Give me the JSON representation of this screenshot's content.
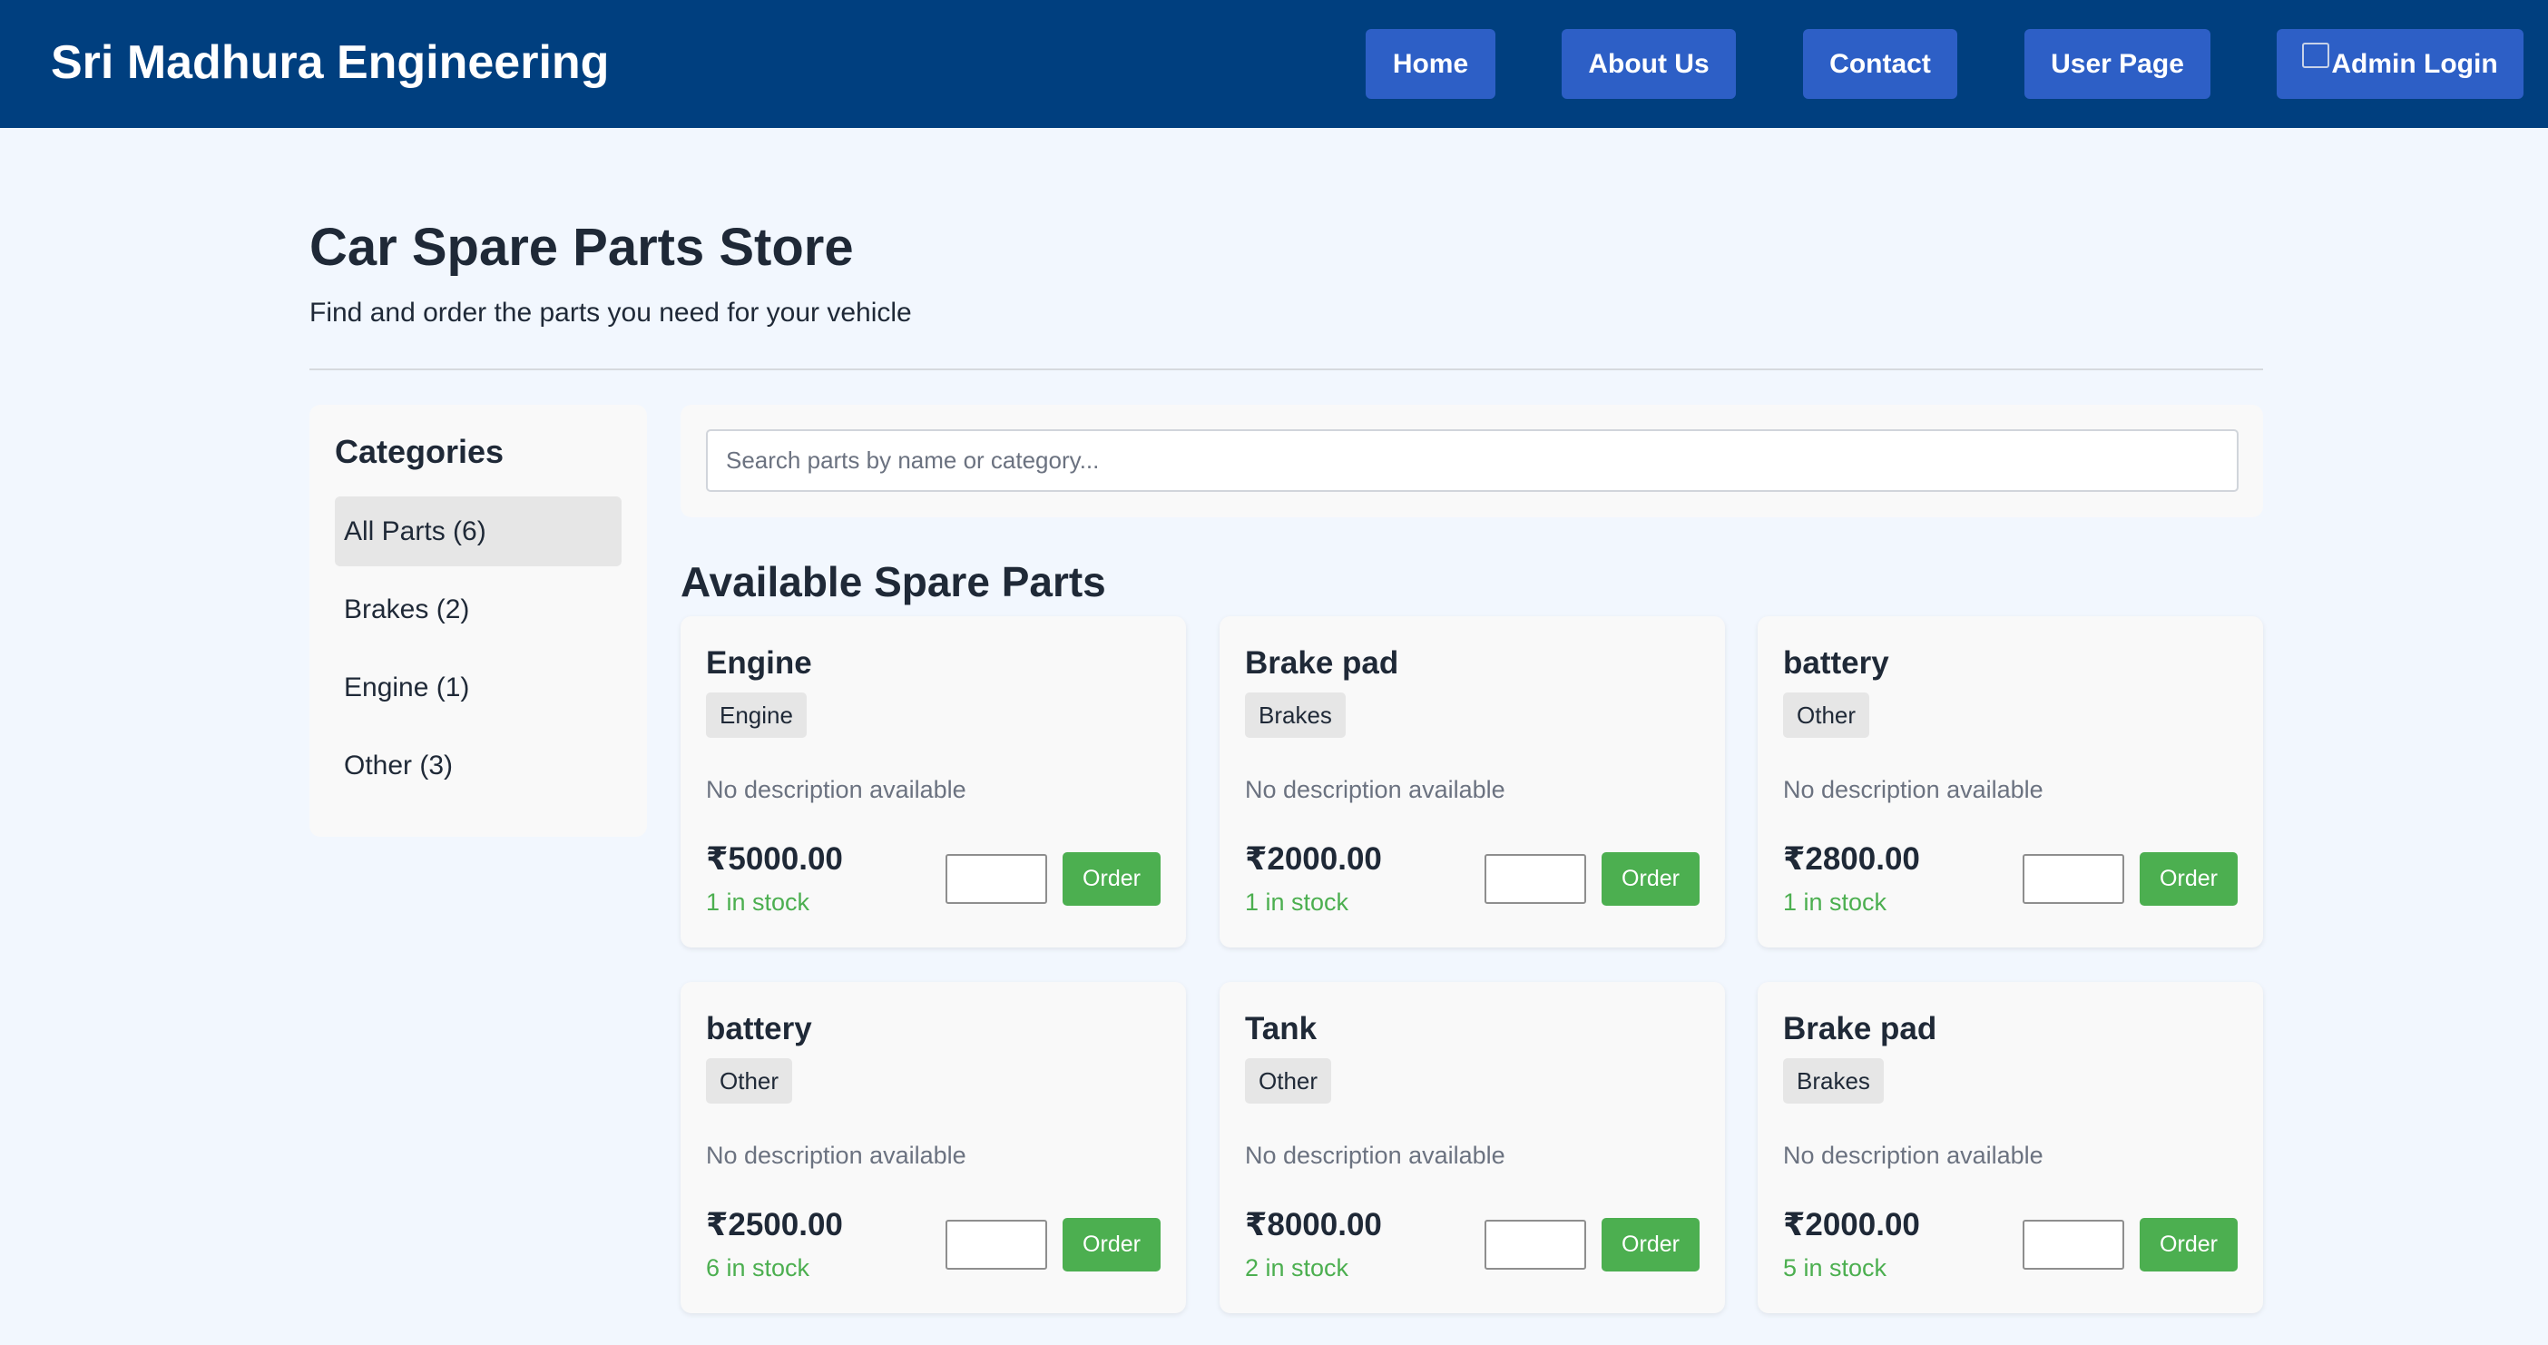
{
  "header": {
    "brand": "Sri Madhura Engineering",
    "nav": [
      {
        "label": "Home"
      },
      {
        "label": "About Us"
      },
      {
        "label": "Contact"
      },
      {
        "label": "User Page"
      },
      {
        "label": "Admin Login"
      }
    ]
  },
  "hero": {
    "title": "Car Spare Parts Store",
    "subtitle": "Find and order the parts you need for your vehicle"
  },
  "categories": {
    "heading": "Categories",
    "items": [
      {
        "label": "All Parts (6)",
        "active": true
      },
      {
        "label": "Brakes (2)",
        "active": false
      },
      {
        "label": "Engine (1)",
        "active": false
      },
      {
        "label": "Other (3)",
        "active": false
      }
    ]
  },
  "search": {
    "placeholder": "Search parts by name or category...",
    "value": ""
  },
  "parts": {
    "heading": "Available Spare Parts",
    "order_label": "Order",
    "items": [
      {
        "name": "Engine",
        "category": "Engine",
        "description": "No description available",
        "price": "₹5000.00",
        "stock": "1 in stock"
      },
      {
        "name": "Brake pad",
        "category": "Brakes",
        "description": "No description available",
        "price": "₹2000.00",
        "stock": "1 in stock"
      },
      {
        "name": "battery",
        "category": "Other",
        "description": "No description available",
        "price": "₹2800.00",
        "stock": "1 in stock"
      },
      {
        "name": "battery",
        "category": "Other",
        "description": "No description available",
        "price": "₹2500.00",
        "stock": "6 in stock"
      },
      {
        "name": "Tank",
        "category": "Other",
        "description": "No description available",
        "price": "₹8000.00",
        "stock": "2 in stock"
      },
      {
        "name": "Brake pad",
        "category": "Brakes",
        "description": "No description available",
        "price": "₹2000.00",
        "stock": "5 in stock"
      }
    ]
  },
  "colors": {
    "header_bg": "#003f7f",
    "nav_button": "#2d5fc6",
    "page_bg": "#f2f7fe",
    "order_button": "#4caf50",
    "stock_text": "#4caf50"
  }
}
